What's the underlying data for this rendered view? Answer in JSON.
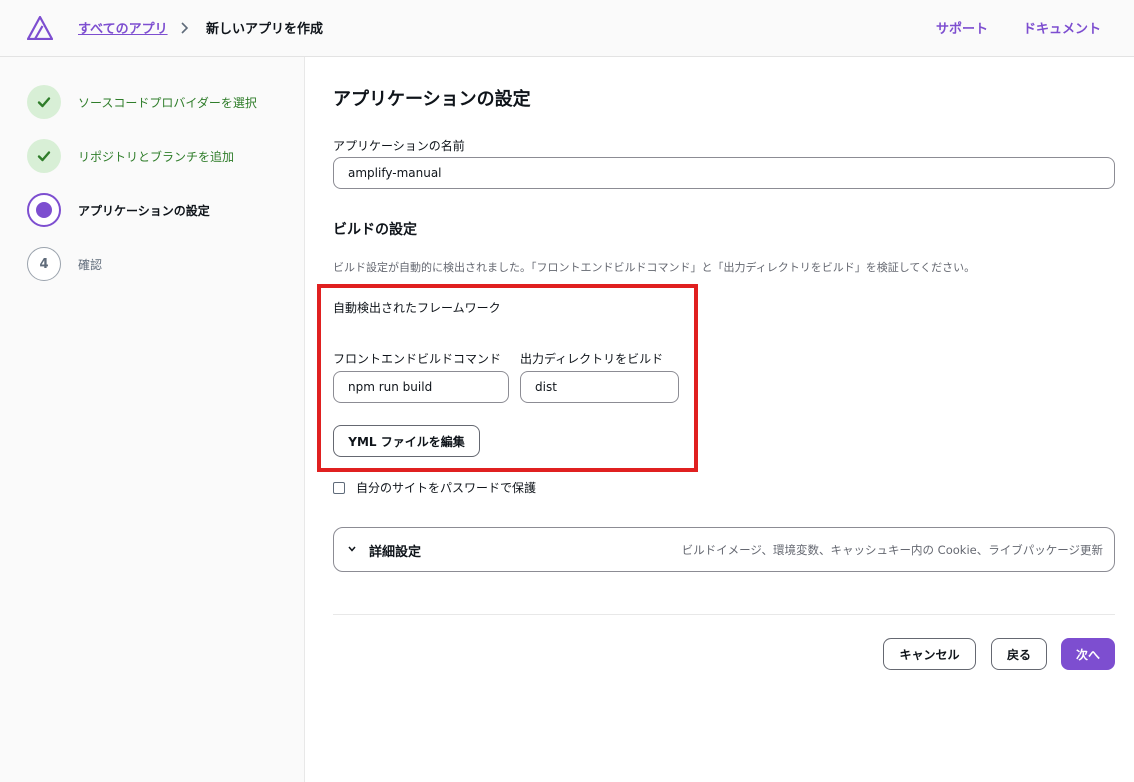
{
  "header": {
    "breadcrumb_root": "すべてのアプリ",
    "breadcrumb_current": "新しいアプリを作成",
    "support": "サポート",
    "docs": "ドキュメント"
  },
  "colors": {
    "accent": "#7d4ed0",
    "success": "#2f7d2a",
    "highlight": "#e02020"
  },
  "steps": [
    {
      "label": "ソースコードプロバイダーを選択",
      "state": "done",
      "icon": "check-icon"
    },
    {
      "label": "リポジトリとブランチを追加",
      "state": "done",
      "icon": "check-icon"
    },
    {
      "label": "アプリケーションの設定",
      "state": "current"
    },
    {
      "label": "確認",
      "state": "todo",
      "number": "4"
    }
  ],
  "main": {
    "title": "アプリケーションの設定",
    "app_name_label": "アプリケーションの名前",
    "app_name_value": "amplify-manual",
    "build_title": "ビルドの設定",
    "build_desc": "ビルド設定が自動的に検出されました。「フロントエンドビルドコマンド」と「出力ディレクトリをビルド」を検証してください。",
    "framework_label": "自動検出されたフレームワーク",
    "build_command_label": "フロントエンドビルドコマンド",
    "build_command_value": "npm run build",
    "output_dir_label": "出力ディレクトリをビルド",
    "output_dir_value": "dist",
    "edit_yml_button": "YML ファイルを編集",
    "password_checkbox_label": "自分のサイトをパスワードで保護",
    "advanced_title": "詳細設定",
    "advanced_desc": "ビルドイメージ、環境変数、キャッシュキー内の Cookie、ライブパッケージ更新"
  },
  "footer": {
    "cancel": "キャンセル",
    "back": "戻る",
    "next": "次へ"
  }
}
